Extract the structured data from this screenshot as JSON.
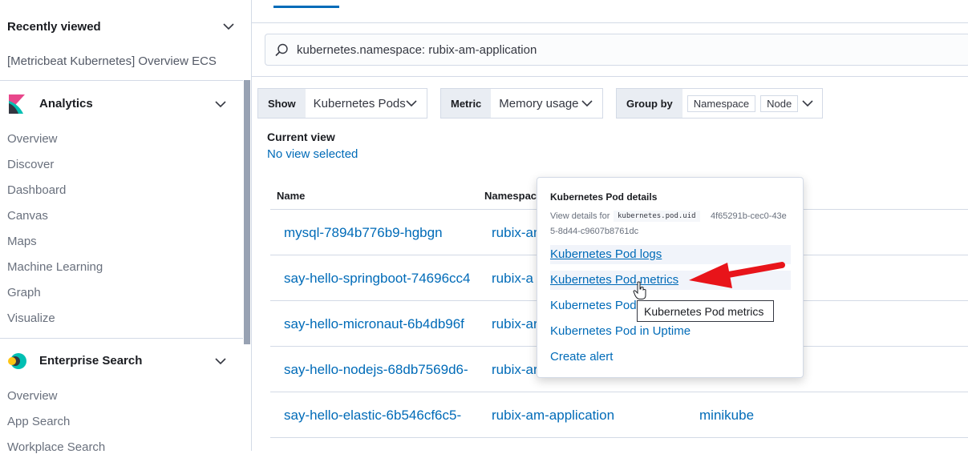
{
  "sidebar": {
    "recently_viewed": {
      "title": "Recently viewed",
      "items": [
        "[Metricbeat Kubernetes] Overview ECS"
      ]
    },
    "analytics": {
      "title": "Analytics",
      "items": [
        "Overview",
        "Discover",
        "Dashboard",
        "Canvas",
        "Maps",
        "Machine Learning",
        "Graph",
        "Visualize"
      ]
    },
    "enterprise_search": {
      "title": "Enterprise Search",
      "items": [
        "Overview",
        "App Search",
        "Workplace Search"
      ]
    }
  },
  "search": {
    "query": "kubernetes.namespace: rubix-am-application"
  },
  "controls": {
    "show": {
      "label": "Show",
      "value": "Kubernetes Pods"
    },
    "metric": {
      "label": "Metric",
      "value": "Memory usage"
    },
    "group_by": {
      "label": "Group by",
      "chips": [
        "Namespace",
        "Node"
      ]
    }
  },
  "current_view": {
    "title": "Current view",
    "value": "No view selected"
  },
  "table": {
    "headers": [
      "Name",
      "Namespace"
    ],
    "rows": [
      {
        "name": "mysql-7894b776b9-hgbgn",
        "namespace": "rubix-am",
        "node": ""
      },
      {
        "name": "say-hello-springboot-74696cc4",
        "namespace": "rubix-a",
        "node": ""
      },
      {
        "name": "say-hello-micronaut-6b4db96f",
        "namespace": "rubix-ar",
        "node": ""
      },
      {
        "name": "say-hello-nodejs-68db7569d6-",
        "namespace": "rubix-ar",
        "node": ""
      },
      {
        "name": "say-hello-elastic-6b546cf6c5-",
        "namespace": "rubix-am-application",
        "node": "minikube"
      }
    ]
  },
  "popover": {
    "title": "Kubernetes Pod details",
    "view_details_label": "View details for",
    "uid_field": "kubernetes.pod.uid",
    "uid_part1": "4f65291b-cec0-43e",
    "uid_part2": "5-8d44-c9607b8761dc",
    "links": [
      "Kubernetes Pod logs",
      "Kubernetes Pod metrics",
      "Kubernetes Pod",
      "Kubernetes Pod in Uptime",
      "Create alert"
    ]
  },
  "tooltip": {
    "text": "Kubernetes Pod metrics"
  },
  "colors": {
    "link": "#006bb8",
    "arrow": "#e8141a"
  },
  "icons": [
    "search-icon",
    "chevron-down-icon",
    "kibana-logo-icon",
    "enterprise-search-logo-icon",
    "hand-cursor-icon",
    "red-arrow-icon"
  ]
}
